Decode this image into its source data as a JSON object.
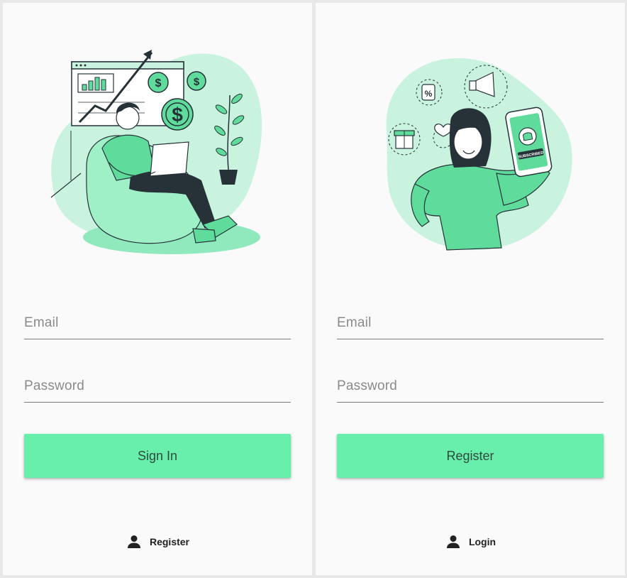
{
  "screens": [
    {
      "id": "login",
      "illustration_icon": "investor-with-laptop-illustration",
      "email_placeholder": "Email",
      "password_placeholder": "Password",
      "primary_button": "Sign In",
      "link_icon": "person-icon",
      "link_label": "Register"
    },
    {
      "id": "register",
      "illustration_icon": "woman-with-phone-subscribed-illustration",
      "email_placeholder": "Email",
      "password_placeholder": "Password",
      "primary_button": "Register",
      "link_icon": "person-icon",
      "link_label": "Login"
    }
  ],
  "illustration_text": {
    "phone_badge": "SUBSCRIBED",
    "tag_symbol": "%",
    "coin_symbol": "$"
  },
  "colors": {
    "accent": "#69efac",
    "illustration_blob": "#c9f3df",
    "illustration_green": "#5fdc9c",
    "dark": "#263238",
    "background": "#fafafa"
  }
}
